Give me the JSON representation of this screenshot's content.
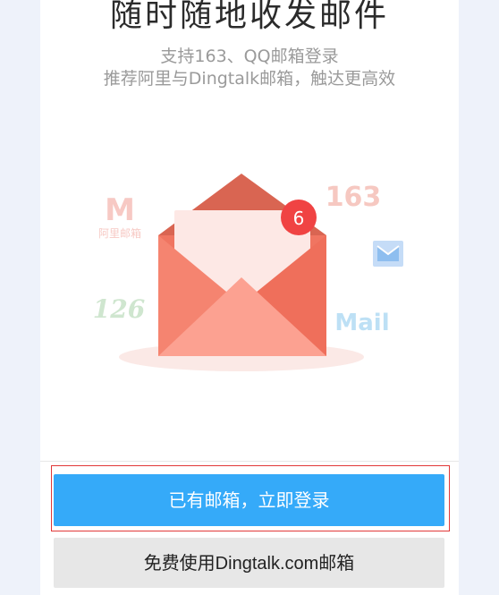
{
  "header": {
    "title": "随时随地收发邮件",
    "subtitle_line1": "支持163、QQ邮箱登录",
    "subtitle_line2": "推荐阿里与Dingtalk邮箱，触达更高效"
  },
  "illustration": {
    "notification_count": "6",
    "logo_aliyun_letter": "M",
    "logo_aliyun_text": "阿里邮箱",
    "logo_163": "163",
    "logo_126": "126",
    "logo_mail": "Mail",
    "icons": [
      "envelope-icon",
      "aliyun-mail-logo",
      "netease-163-logo",
      "netease-126-logo",
      "qq-mail-logo",
      "mail-logo"
    ]
  },
  "actions": {
    "login_label": "已有邮箱，立即登录",
    "free_label": "免费使用Dingtalk.com邮箱"
  },
  "colors": {
    "primary": "#35aaf9",
    "envelope": "#f07561",
    "badge": "#f04343"
  }
}
